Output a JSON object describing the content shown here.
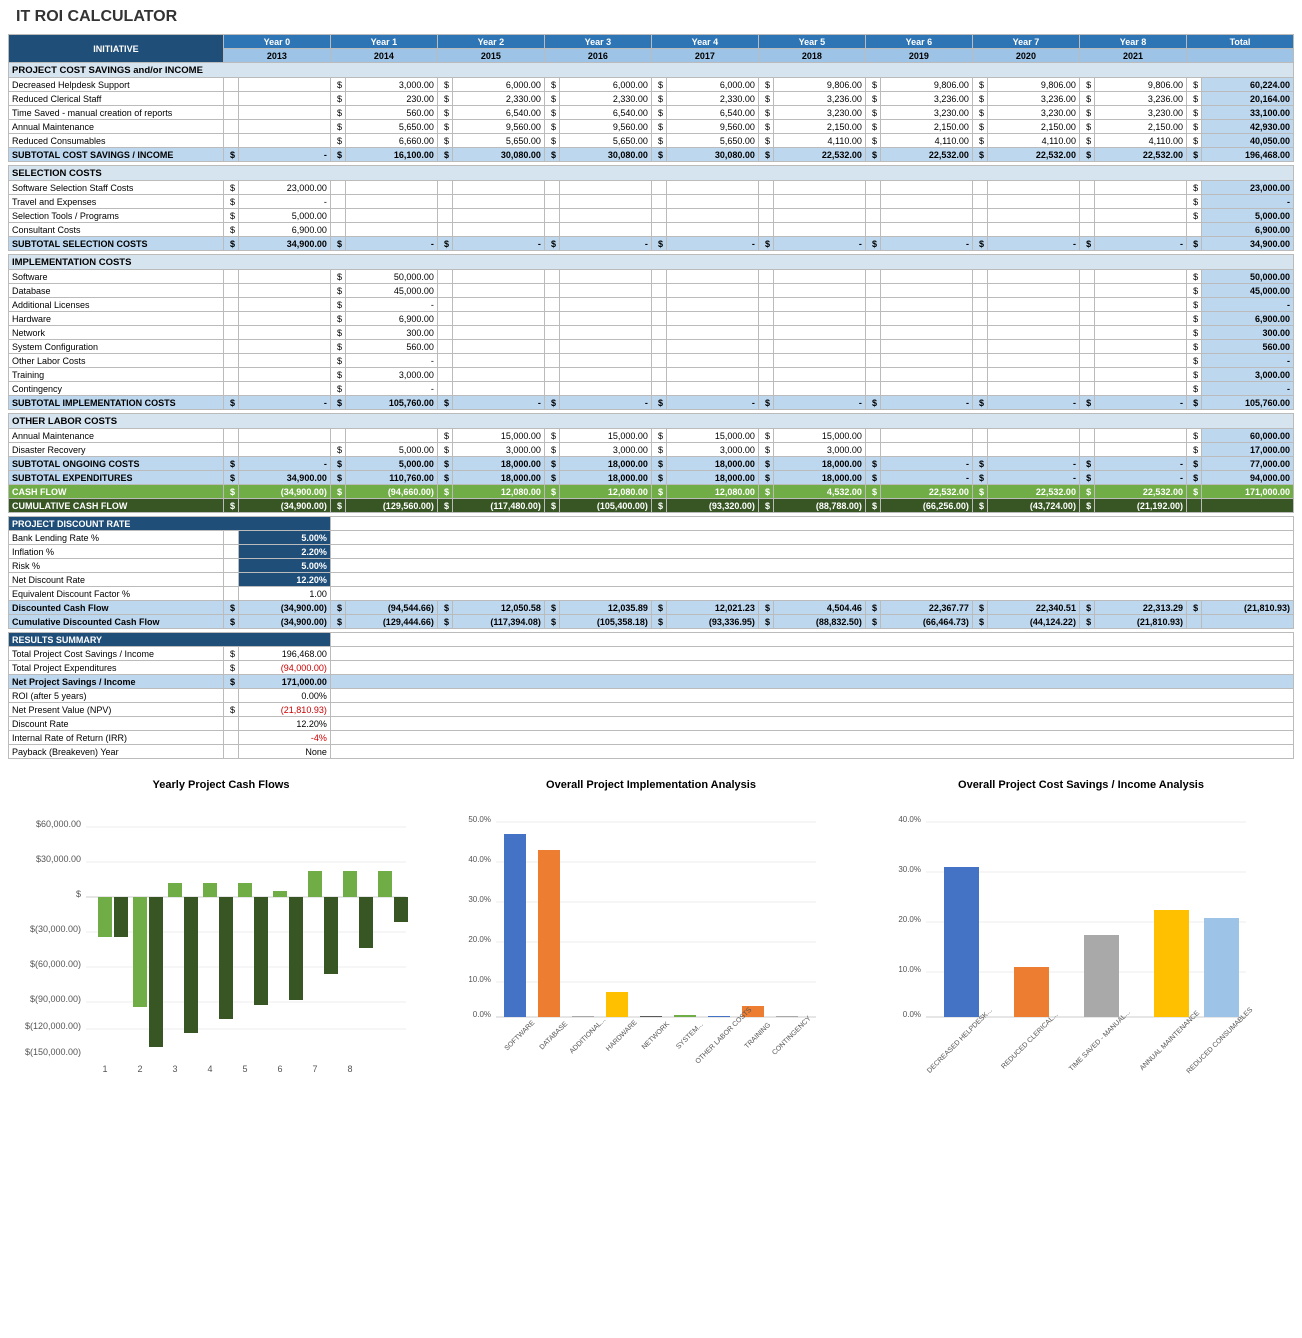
{
  "title": "IT ROI CALCULATOR",
  "headers": {
    "initiative": "INITIATIVE",
    "yr0": "Year 0",
    "yr1": "Year 1",
    "yr2": "Year 2",
    "yr3": "Year 3",
    "yr4": "Year 4",
    "yr5": "Year 5",
    "yr6": "Year 6",
    "yr7": "Year 7",
    "yr8": "Year 8",
    "total": "Total",
    "yr0sub": "2013",
    "yr1sub": "2014",
    "yr2sub": "2015",
    "yr3sub": "2016",
    "yr4sub": "2017",
    "yr5sub": "2018",
    "yr6sub": "2019",
    "yr7sub": "2020",
    "yr8sub": "2021"
  },
  "sections": {
    "cost_savings": "PROJECT COST SAVINGS and/or INCOME",
    "selection": "SELECTION COSTS",
    "implementation": "IMPLEMENTATION COSTS",
    "other_labor": "OTHER LABOR COSTS",
    "project_discount": "PROJECT DISCOUNT RATE",
    "results": "RESULTS SUMMARY"
  },
  "charts": {
    "cashflow_title": "Yearly Project Cash Flows",
    "impl_title": "Overall Project Implementation Analysis",
    "savings_title": "Overall Project Cost Savings / Income Analysis",
    "cashflow_legend_cf": "Cash Flow",
    "cashflow_legend_cum": "Cumulative Cash Flow"
  }
}
